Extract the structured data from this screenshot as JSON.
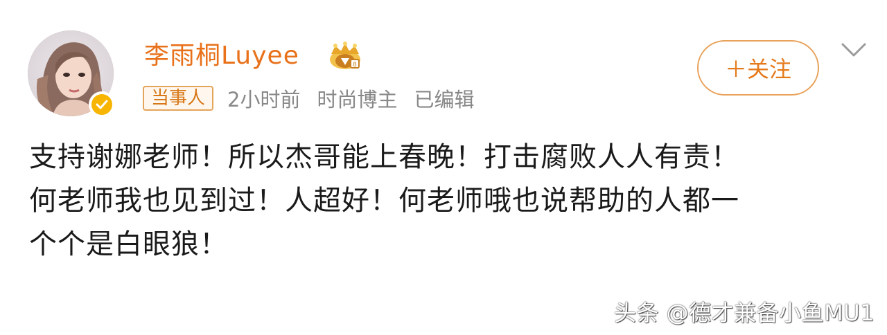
{
  "post": {
    "author": {
      "name": "李雨桐Luyee",
      "avatar_icon": "avatar",
      "verified_icon": "verified-badge-icon",
      "crown_icon": "crown-icon"
    },
    "meta": {
      "badge": "当事人",
      "time": "2小时前",
      "category": "时尚博主",
      "edited": "已编辑"
    },
    "follow_label": "＋关注",
    "menu_icon": "chevron-down-icon",
    "content_lines": [
      "支持谢娜老师！所以杰哥能上春晚！打击腐败人人有责！",
      "何老师我也见到过！人超好！何老师哦也说帮助的人都一",
      "个个是白眼狼！"
    ]
  },
  "watermark": "头条 @德才兼备小鱼MU1",
  "colors": {
    "username": "#e8711a",
    "accent": "#e57a1c",
    "meta_text": "#888888",
    "verified": "#f7b500"
  }
}
